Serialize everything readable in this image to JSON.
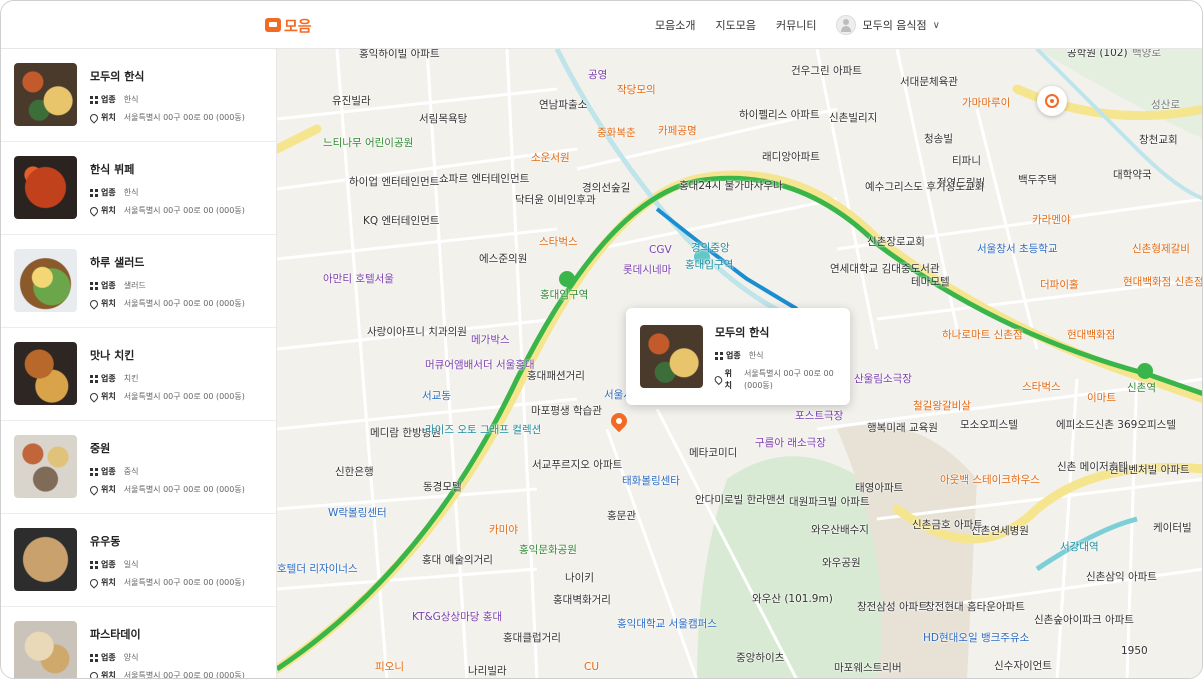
{
  "header": {
    "logo": "모음",
    "nav": [
      "모음소개",
      "지도모음",
      "커뮤니티"
    ],
    "user_name": "모두의 음식점",
    "chevron": "∨"
  },
  "labels": {
    "category": "업종",
    "location": "위치"
  },
  "restaurants": [
    {
      "name": "모두의 한식",
      "category": "한식",
      "address": "서울특별시 00구 00로 00 (000동)"
    },
    {
      "name": "한식 뷔페",
      "category": "한식",
      "address": "서울특별시 00구 00로 00 (000동)"
    },
    {
      "name": "하루 샐러드",
      "category": "샐러드",
      "address": "서울특별시 00구 00로 00 (000동)"
    },
    {
      "name": "맛나 치킨",
      "category": "치킨",
      "address": "서울특별시 00구 00로 00 (000동)"
    },
    {
      "name": "중원",
      "category": "중식",
      "address": "서울특별시 00구 00로 00 (000동)"
    },
    {
      "name": "유우동",
      "category": "일식",
      "address": "서울특별시 00구 00로 00 (000동)"
    },
    {
      "name": "파스타데이",
      "category": "양식",
      "address": "서울특별시 00구 00로 00 (000동)"
    }
  ],
  "popup": {
    "name": "모두의 한식",
    "category": "한식",
    "address": "서울특별시 00구 00로 00 (000동)"
  },
  "map_labels": [
    "홍익하이빌 아파트",
    "유진빌라",
    "서림목욕탕",
    "연남파출소",
    "공영",
    "작당모의",
    "중화복춘",
    "카페공명",
    "소운서원",
    "하이펠리스 아파트",
    "래디앙아파트",
    "건우그린 아파트",
    "서대문체육관",
    "신촌빌리지",
    "가마마루이",
    "청송빌",
    "티파니",
    "정연드림빌",
    "백두주택",
    "대학약국",
    "창천교회",
    "공학원 (102)",
    "백양로",
    "성산로",
    "느티나무 어린이공원",
    "하이업 엔터테인먼트",
    "쇼파르 엔터테인먼트",
    "닥터윤 이비인후과",
    "KQ 엔터테인먼트",
    "에스준의원",
    "스타벅스",
    "CGV",
    "롯데시네마",
    "홍대입구역",
    "경의중앙",
    "홍대24시 불가마사우나",
    "경의선숲길",
    "예수그리스도 후기성도교회",
    "카라멘야",
    "신촌장로교회",
    "서울창서 초등학교",
    "연세대학교 김대중도서관",
    "테마모텔",
    "더파이홀",
    "현대백화점 신촌점",
    "신촌형제갈비",
    "아만티 호텔서울",
    "사랑이아프니 치과의원",
    "메가박스",
    "머큐어앰배서더 서울홍대",
    "서교동",
    "홍대패션거리",
    "마포평생 학습관",
    "서울서교 초등학교",
    "메디람 한방병원",
    "라이즈 오토 그래프 컬렉션",
    "메타코미디",
    "구름아 래소극장",
    "포스트극장",
    "산울림소극장",
    "철길왕갈비살",
    "하나로마트 신촌점",
    "행복미래 교육원",
    "모소오피스텔",
    "에피소드신촌 369오피스텔",
    "현대백화점",
    "스타벅스",
    "이마트",
    "신촌역",
    "신한은행",
    "동경모텔",
    "서교푸르지오 아파트",
    "태화볼링센타",
    "W락볼링센터",
    "홍문관",
    "안다미로빌 한라맨션",
    "대원파크빌 아파트",
    "태영아파트",
    "아웃백 스테이크하우스",
    "신촌연세병원",
    "신촌 메이저호텔",
    "현대벤처빌 아파트",
    "카미야",
    "홍익문화공원",
    "홍대 예술의거리",
    "와우산배수지",
    "와우공원",
    "신촌금호 아파트",
    "서강대역",
    "케이터빌",
    "나이키",
    "홍대벽화거리",
    "KT&G상상마당 홍대",
    "홍익대학교 서울캠퍼스",
    "와우산 (101.9m)",
    "창전삼성 아파트",
    "창전현대 홈타운아파트",
    "신촌숲아이파크 아파트",
    "신촌삼익 아파트",
    "홍대클럽거리",
    "HD현대오일 뱅크주유소",
    "중앙하이츠",
    "마포웨스트리버",
    "신수자이언트",
    "1950",
    "피오니",
    "나리빌라",
    "CU",
    "호텔더 리자이너스",
    "홍대입구역"
  ],
  "colors": {
    "brand": "#f26b24",
    "line2": "#3ab54a",
    "gyeongui": "#63c6c7",
    "airport": "#1b8ed2"
  }
}
